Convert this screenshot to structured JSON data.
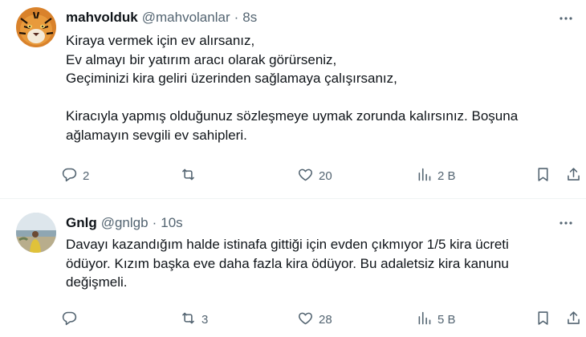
{
  "tweets": [
    {
      "name": "mahvolduk",
      "handle": "@mahvolanlar",
      "separator": "·",
      "time": "8s",
      "lines": [
        "Kiraya vermek için ev alırsanız,",
        "Ev almayı bir yatırım aracı olarak görürseniz,",
        "Geçiminizi kira geliri üzerinden sağlamaya çalışırsanız,",
        "",
        "Kiracıyla yapmış olduğunuz sözleşmeye uymak zorunda kalırsınız. Boşuna",
        "ağlamayın sevgili ev sahipleri."
      ],
      "reply_count": "2",
      "retweet_count": "",
      "like_count": "20",
      "view_count": "2 B"
    },
    {
      "name": "Gnlg",
      "handle": "@gnlgb",
      "separator": "·",
      "time": "10s",
      "lines": [
        "Davayı kazandığım halde istinafa gittiği için evden çıkmıyor 1/5 kira ücreti",
        "ödüyor. Kızım başka eve daha fazla kira ödüyor. Bu adaletsiz kira kanunu",
        "değişmeli."
      ],
      "reply_count": "",
      "retweet_count": "3",
      "like_count": "28",
      "view_count": "5 B"
    }
  ],
  "icons": {
    "more": "more-icon",
    "reply": "reply-icon",
    "retweet": "retweet-icon",
    "like": "like-icon",
    "views": "views-icon",
    "bookmark": "bookmark-icon",
    "share": "share-icon"
  },
  "colors": {
    "text": "#0f1419",
    "secondary": "#536471",
    "divider": "#eff3f4"
  }
}
